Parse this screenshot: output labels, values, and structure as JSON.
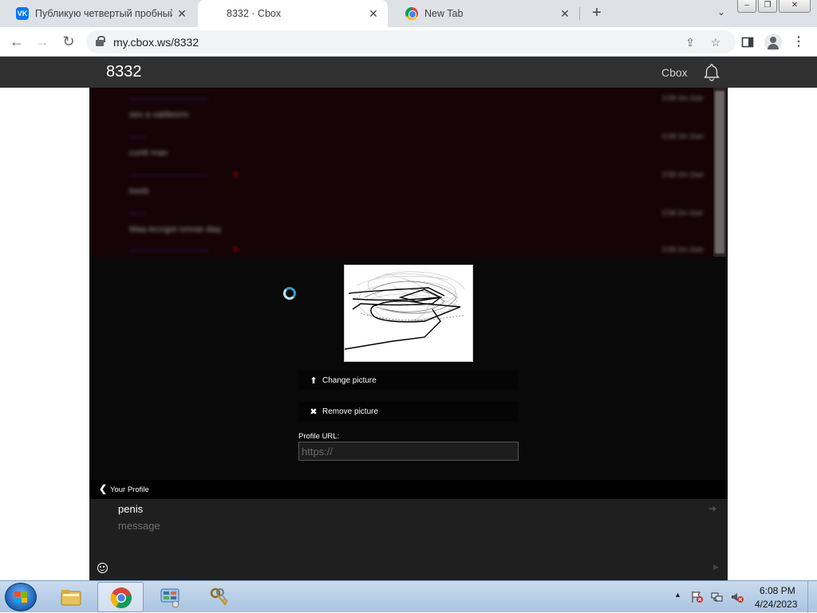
{
  "browser": {
    "tabs": [
      {
        "title": "Публикую четвертый пробный",
        "icon": "vk-icon",
        "active": false
      },
      {
        "title": "8332 · Cbox",
        "icon": "",
        "active": true
      },
      {
        "title": "New Tab",
        "icon": "chrome-icon",
        "active": false
      }
    ],
    "vk_label": "VK",
    "url": "my.cbox.ws/8332"
  },
  "site": {
    "title": "8332",
    "brand": "Cbox"
  },
  "chat": {
    "messages": [
      {
        "name": "—————————",
        "text": "sex a valdeorm",
        "time": "3:58 2m 2ser"
      },
      {
        "name": "——",
        "text": "cuntt man",
        "time": "3:58 2m 2ser"
      },
      {
        "name": "—————————",
        "text": "boob",
        "time": "3:58 2m 2ser"
      },
      {
        "name": "——",
        "text": "Maa Arcrgot nmrse daq",
        "time": "3:58 2m 2ser"
      },
      {
        "name": "—————————",
        "text": "",
        "time": "3:58 2m 2ser"
      }
    ]
  },
  "profile": {
    "change_picture": "Change picture",
    "remove_picture": "Remove picture",
    "url_label": "Profile URL:",
    "url_placeholder": "https://",
    "back_label": "Your Profile"
  },
  "compose": {
    "name": "penis",
    "message_placeholder": "message"
  },
  "taskbar": {
    "time": "6:08 PM",
    "date": "4/24/2023"
  },
  "colors": {
    "header_bg": "#303030",
    "panel_bg": "#0a0909",
    "chat_bg": "#150306",
    "spinner": "#2aa0c8"
  }
}
